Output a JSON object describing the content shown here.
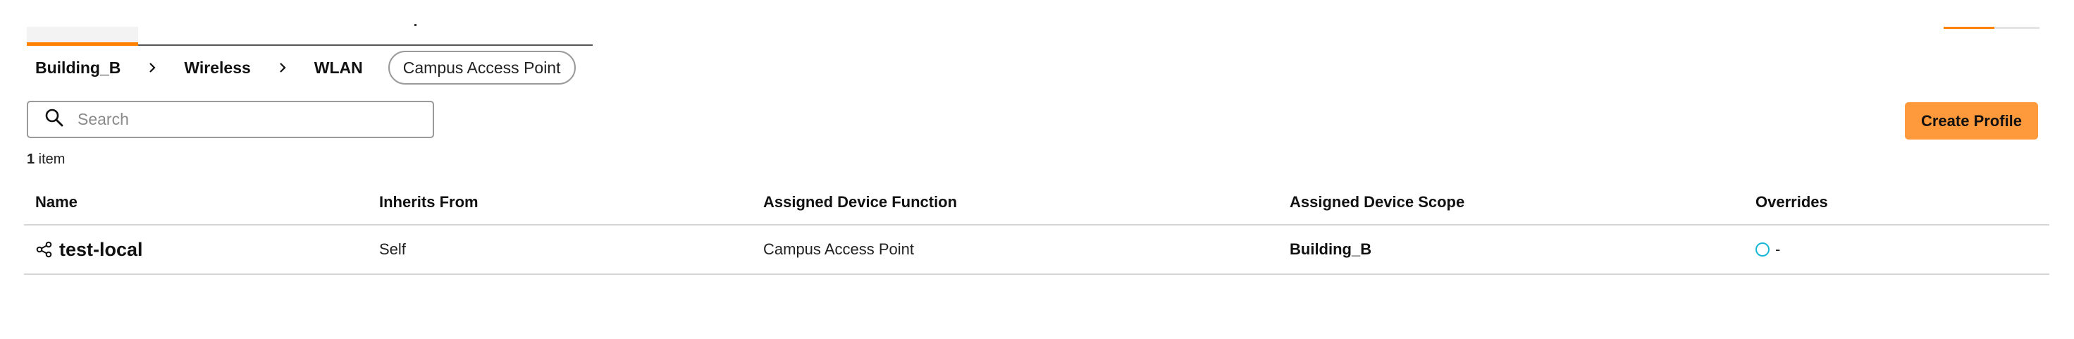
{
  "breadcrumb": {
    "items": [
      "Building_B",
      "Wireless",
      "WLAN"
    ],
    "current": "Campus Access Point"
  },
  "search": {
    "placeholder": "Search",
    "value": ""
  },
  "toolbar": {
    "create_label": "Create Profile"
  },
  "summary": {
    "count": "1",
    "count_suffix": " item"
  },
  "table": {
    "columns": [
      "Name",
      "Inherits From",
      "Assigned Device Function",
      "Assigned Device Scope",
      "Overrides"
    ],
    "rows": [
      {
        "name": "test-local",
        "inherits_from": "Self",
        "device_function": "Campus Access Point",
        "device_scope": "Building_B",
        "overrides": "-"
      }
    ]
  },
  "colors": {
    "accent": "#ff9a3c",
    "tab_accent": "#ff8300",
    "override_indicator": "#17b8d6"
  },
  "icons": {
    "search": "search-icon",
    "breadcrumb_separator": "chevron-right-icon",
    "row_name": "share-icon",
    "override_status": "circle-outline-icon"
  }
}
